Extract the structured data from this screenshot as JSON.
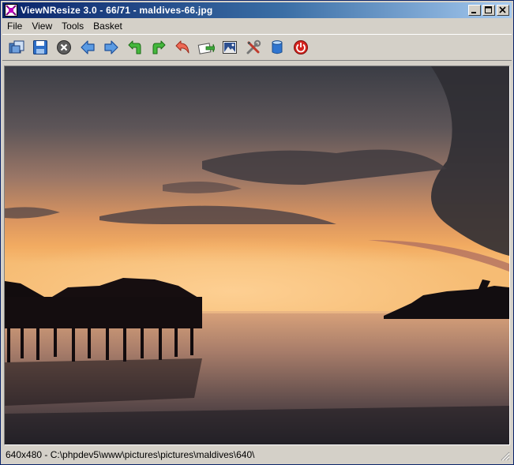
{
  "window": {
    "title": "ViewNResize 3.0 - 66/71 - maldives-66.jpg"
  },
  "menu": {
    "items": [
      "File",
      "View",
      "Tools",
      "Basket"
    ]
  },
  "toolbar": {
    "buttons": [
      {
        "name": "open-folder-icon"
      },
      {
        "name": "save-icon"
      },
      {
        "name": "close-image-icon"
      },
      {
        "name": "previous-icon"
      },
      {
        "name": "next-icon"
      },
      {
        "name": "rotate-left-icon"
      },
      {
        "name": "rotate-right-icon"
      },
      {
        "name": "undo-icon"
      },
      {
        "name": "send-icon"
      },
      {
        "name": "picture-icon"
      },
      {
        "name": "settings-tools-icon"
      },
      {
        "name": "basket-icon"
      },
      {
        "name": "power-icon"
      }
    ]
  },
  "status": {
    "text": "640x480 - C:\\phpdev5\\www\\pictures\\pictures\\maldives\\640\\"
  },
  "colors": {
    "title_start": "#0a246a",
    "title_end": "#a6caf0",
    "chrome": "#d4d0c8"
  }
}
